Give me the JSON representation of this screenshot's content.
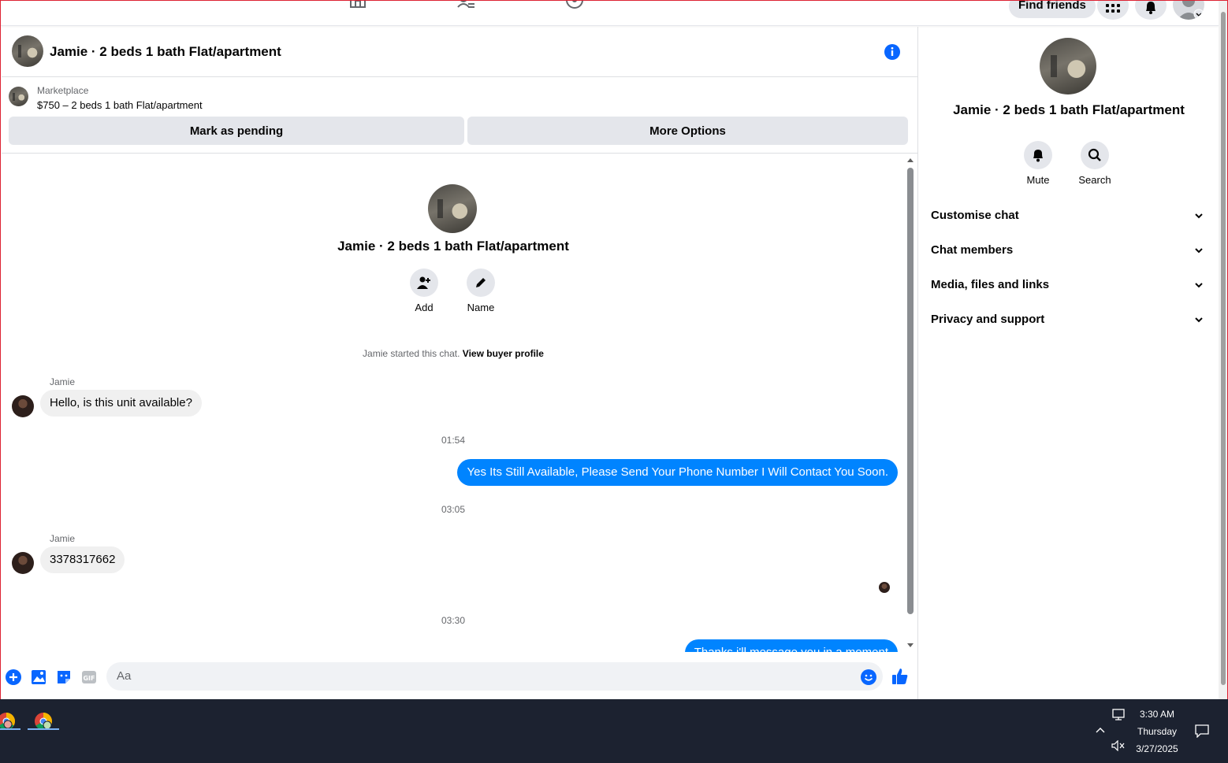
{
  "topnav": {
    "find_friends": "Find friends"
  },
  "chat": {
    "title": "Jamie · 2 beds 1 bath Flat/apartment",
    "marketplace_label": "Marketplace",
    "listing": "$750 – 2 beds 1 bath Flat/apartment",
    "mark_pending": "Mark as pending",
    "more_options": "More Options",
    "center_title": "Jamie · 2 beds 1 bath Flat/apartment",
    "add_label": "Add",
    "name_label": "Name",
    "started_text": "Jamie started this chat.",
    "view_buyer_profile": "View buyer profile",
    "messages": [
      {
        "sender": "Jamie",
        "text": "Hello, is this unit available?"
      },
      {
        "time": "01:54"
      },
      {
        "text": "Yes Its Still Available, Please Send Your Phone Number I Will Contact You Soon."
      },
      {
        "time": "03:05"
      },
      {
        "sender": "Jamie",
        "text": "3378317662"
      },
      {
        "time": "03:30"
      },
      {
        "text": "Thanks i'll message you in a moment"
      }
    ],
    "composer_placeholder": "Aa"
  },
  "right_panel": {
    "title": "Jamie · 2 beds 1 bath Flat/apartment",
    "mute_label": "Mute",
    "search_label": "Search",
    "sections": [
      "Customise chat",
      "Chat members",
      "Media, files and links",
      "Privacy and support"
    ]
  },
  "taskbar": {
    "time": "3:30 AM",
    "day": "Thursday",
    "date": "3/27/2025"
  },
  "colors": {
    "accent": "#0084ff",
    "icon_blue": "#0866ff",
    "bubble_in": "#f0f0f0"
  }
}
